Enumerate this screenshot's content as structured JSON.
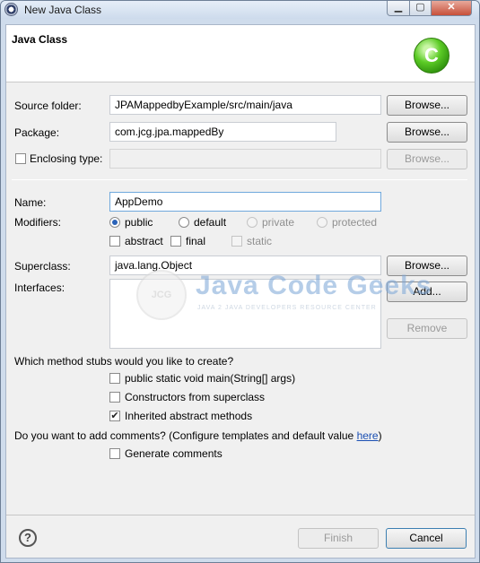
{
  "window": {
    "title": "New Java Class",
    "min_label": "▁",
    "max_label": "▢",
    "close_label": "✕"
  },
  "header": {
    "title": "Java Class",
    "logo_letter": "C"
  },
  "source_folder": {
    "label": "Source folder:",
    "value": "JPAMappedbyExample/src/main/java",
    "browse": "Browse..."
  },
  "package": {
    "label": "Package:",
    "value": "com.jcg.jpa.mappedBy",
    "browse": "Browse..."
  },
  "enclosing": {
    "label": "Enclosing type:",
    "value": "",
    "browse": "Browse..."
  },
  "name": {
    "label": "Name:",
    "value": "AppDemo"
  },
  "modifiers": {
    "label": "Modifiers:",
    "options": [
      "public",
      "default",
      "private",
      "protected"
    ],
    "selected": "public",
    "extra": [
      "abstract",
      "final",
      "static"
    ]
  },
  "superclass": {
    "label": "Superclass:",
    "value": "java.lang.Object",
    "browse": "Browse..."
  },
  "interfaces": {
    "label": "Interfaces:",
    "add": "Add...",
    "remove": "Remove"
  },
  "stubs": {
    "question": "Which method stubs would you like to create?",
    "options": [
      {
        "label": "public static void main(String[] args)",
        "checked": false
      },
      {
        "label": "Constructors from superclass",
        "checked": false
      },
      {
        "label": "Inherited abstract methods",
        "checked": true
      }
    ]
  },
  "comments": {
    "question": "Do you want to add comments? (Configure templates and default value ",
    "link": "here",
    "close_paren": ")",
    "option": "Generate comments",
    "checked": false
  },
  "watermark": {
    "circle_text": "JCG",
    "title": "Java Code Geeks",
    "subtitle": "JAVA 2 JAVA DEVELOPERS RESOURCE CENTER"
  },
  "footer": {
    "help": "?",
    "finish": "Finish",
    "cancel": "Cancel"
  },
  "colors": {
    "accent": "#2a63b8",
    "link": "#1a4fb3",
    "logo": "#4fbf1f"
  },
  "icons": {
    "app": "eclipse-icon",
    "help": "help-icon",
    "logo": "java-class-logo-icon"
  }
}
